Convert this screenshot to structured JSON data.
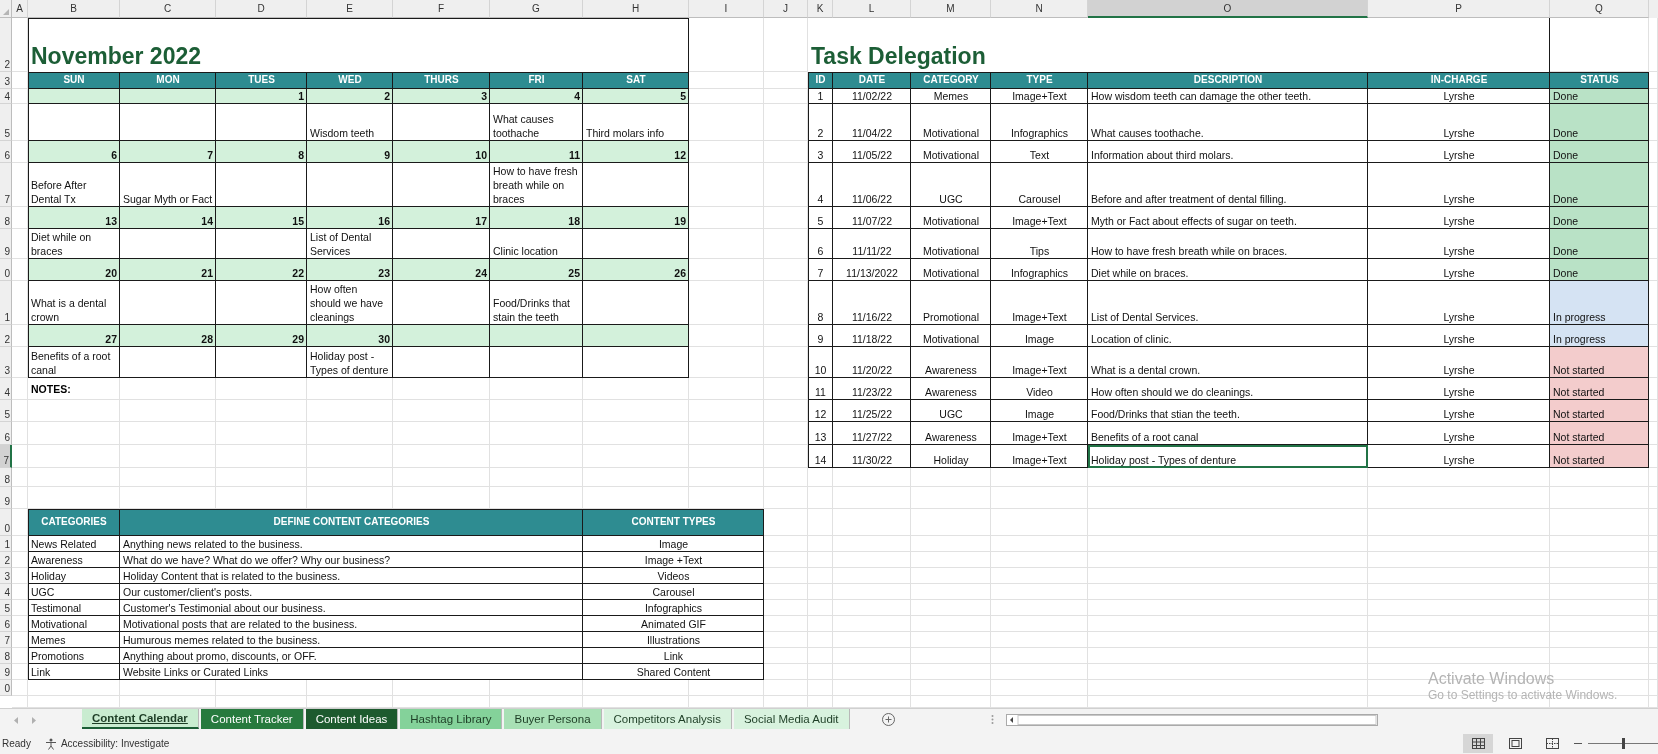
{
  "column_headers": [
    {
      "label": "A",
      "selected": false
    },
    {
      "label": "B",
      "selected": false
    },
    {
      "label": "C",
      "selected": false
    },
    {
      "label": "D",
      "selected": false
    },
    {
      "label": "E",
      "selected": false
    },
    {
      "label": "F",
      "selected": false
    },
    {
      "label": "G",
      "selected": false
    },
    {
      "label": "H",
      "selected": false
    },
    {
      "label": "I",
      "selected": false
    },
    {
      "label": "J",
      "selected": false
    },
    {
      "label": "K",
      "selected": false
    },
    {
      "label": "L",
      "selected": false
    },
    {
      "label": "M",
      "selected": false
    },
    {
      "label": "N",
      "selected": false
    },
    {
      "label": "O",
      "selected": true
    },
    {
      "label": "P",
      "selected": false
    },
    {
      "label": "Q",
      "selected": false
    }
  ],
  "row_headers": [
    {
      "label": "2",
      "selected": false
    },
    {
      "label": "3",
      "selected": false
    },
    {
      "label": "4",
      "selected": false
    },
    {
      "label": "5",
      "selected": false
    },
    {
      "label": "6",
      "selected": false
    },
    {
      "label": "7",
      "selected": false
    },
    {
      "label": "8",
      "selected": false
    },
    {
      "label": "9",
      "selected": false
    },
    {
      "label": "0",
      "selected": false
    },
    {
      "label": "1",
      "selected": false
    },
    {
      "label": "2",
      "selected": false
    },
    {
      "label": "3",
      "selected": false
    },
    {
      "label": "4",
      "selected": false
    },
    {
      "label": "5",
      "selected": false
    },
    {
      "label": "6",
      "selected": false
    },
    {
      "label": "7",
      "selected": true
    },
    {
      "label": "8",
      "selected": false
    },
    {
      "label": "9",
      "selected": false
    },
    {
      "label": "0",
      "selected": false
    },
    {
      "label": "1",
      "selected": false
    },
    {
      "label": "2",
      "selected": false
    },
    {
      "label": "3",
      "selected": false
    },
    {
      "label": "4",
      "selected": false
    },
    {
      "label": "5",
      "selected": false
    },
    {
      "label": "6",
      "selected": false
    },
    {
      "label": "7",
      "selected": false
    },
    {
      "label": "8",
      "selected": false
    },
    {
      "label": "9",
      "selected": false
    },
    {
      "label": "0",
      "selected": false
    }
  ],
  "calendar": {
    "title": "November 2022",
    "weekdays": [
      "SUN",
      "MON",
      "TUES",
      "WED",
      "THURS",
      "FRI",
      "SAT"
    ],
    "weeks": [
      {
        "days": [
          {
            "kind": "empty"
          },
          {
            "kind": "empty"
          },
          {
            "day": "1"
          },
          {
            "day": "2",
            "post": "Wisdom teeth"
          },
          {
            "day": "3"
          },
          {
            "day": "4",
            "post": "What causes toothache"
          },
          {
            "day": "5",
            "post": "Third molars info"
          }
        ]
      },
      {
        "days": [
          {
            "day": "6",
            "post": "Before After Dental Tx"
          },
          {
            "day": "7",
            "post": "Sugar Myth or Fact"
          },
          {
            "day": "8"
          },
          {
            "day": "9"
          },
          {
            "day": "10"
          },
          {
            "day": "11",
            "post": "How to have fresh breath while on braces"
          },
          {
            "day": "12"
          }
        ]
      },
      {
        "days": [
          {
            "day": "13",
            "post": "Diet while on braces"
          },
          {
            "day": "14"
          },
          {
            "day": "15"
          },
          {
            "day": "16",
            "post": "List of Dental Services"
          },
          {
            "day": "17"
          },
          {
            "day": "18",
            "post": "Clinic location"
          },
          {
            "day": "19"
          }
        ]
      },
      {
        "days": [
          {
            "day": "20",
            "post": "What is a dental crown"
          },
          {
            "day": "21"
          },
          {
            "day": "22"
          },
          {
            "day": "23",
            "post": "How often should we have cleanings"
          },
          {
            "day": "24"
          },
          {
            "day": "25",
            "post": "Food/Drinks that stain the teeth"
          },
          {
            "day": "26"
          }
        ]
      },
      {
        "days": [
          {
            "day": "27",
            "post": "Benefits of a root canal"
          },
          {
            "day": "28"
          },
          {
            "day": "29"
          },
          {
            "day": "30",
            "post": "Holiday post - Types of denture"
          },
          {
            "kind": "empty"
          },
          {
            "kind": "empty"
          },
          {
            "kind": "empty"
          }
        ]
      }
    ],
    "notes_label": "NOTES:"
  },
  "task_delegation": {
    "title": "Task Delegation",
    "columns": [
      "ID",
      "DATE",
      "CATEGORY",
      "TYPE",
      "DESCRIPTION",
      "IN-CHARGE",
      "STATUS"
    ],
    "rows": [
      {
        "id": "1",
        "date": "11/02/22",
        "category": "Memes",
        "type": "Image+Text",
        "description": "How wisdom teeth can damage the other teeth.",
        "in_charge": "Lyrshe",
        "status": "Done",
        "color": "#b9e2c6",
        "selected": false
      },
      {
        "id": "2",
        "date": "11/04/22",
        "category": "Motivational",
        "type": "Infographics",
        "description": "What causes toothache.",
        "in_charge": "Lyrshe",
        "status": "Done",
        "color": "#b9e2c6",
        "selected": false
      },
      {
        "id": "3",
        "date": "11/05/22",
        "category": "Motivational",
        "type": "Text",
        "description": "Information about third molars.",
        "in_charge": "Lyrshe",
        "status": "Done",
        "color": "#b9e2c6",
        "selected": false
      },
      {
        "id": "4",
        "date": "11/06/22",
        "category": "UGC",
        "type": "Carousel",
        "description": "Before and after treatment of dental filling.",
        "in_charge": "Lyrshe",
        "status": "Done",
        "color": "#b9e2c6",
        "selected": false
      },
      {
        "id": "5",
        "date": "11/07/22",
        "category": "Motivational",
        "type": "Image+Text",
        "description": "Myth or Fact about effects of sugar on teeth.",
        "in_charge": "Lyrshe",
        "status": "Done",
        "color": "#b9e2c6",
        "selected": false
      },
      {
        "id": "6",
        "date": "11/11/22",
        "category": "Motivational",
        "type": "Tips",
        "description": "How to have fresh breath while on braces.",
        "in_charge": "Lyrshe",
        "status": "Done",
        "color": "#b9e2c6",
        "selected": false
      },
      {
        "id": "7",
        "date": "11/13/2022",
        "category": "Motivational",
        "type": "Infographics",
        "description": "Diet while on braces.",
        "in_charge": "Lyrshe",
        "status": "Done",
        "color": "#b9e2c6",
        "selected": false
      },
      {
        "id": "8",
        "date": "11/16/22",
        "category": "Promotional",
        "type": "Image+Text",
        "description": "List of Dental Services.",
        "in_charge": "Lyrshe",
        "status": "In progress",
        "color": "#d5e3f3",
        "selected": false
      },
      {
        "id": "9",
        "date": "11/18/22",
        "category": "Motivational",
        "type": "Image",
        "description": "Location of clinic.",
        "in_charge": "Lyrshe",
        "status": "In progress",
        "color": "#d5e3f3",
        "selected": false
      },
      {
        "id": "10",
        "date": "11/20/22",
        "category": "Awareness",
        "type": "Image+Text",
        "description": "What is a dental crown.",
        "in_charge": "Lyrshe",
        "status": "Not started",
        "color": "#f3cccc",
        "selected": false
      },
      {
        "id": "11",
        "date": "11/23/22",
        "category": "Awareness",
        "type": "Video",
        "description": "How often should we do cleanings.",
        "in_charge": "Lyrshe",
        "status": "Not started",
        "color": "#f3cccc",
        "selected": false
      },
      {
        "id": "12",
        "date": "11/25/22",
        "category": "UGC",
        "type": "Image",
        "description": "Food/Drinks that stian the teeth.",
        "in_charge": "Lyrshe",
        "status": "Not started",
        "color": "#f3cccc",
        "selected": false
      },
      {
        "id": "13",
        "date": "11/27/22",
        "category": "Awareness",
        "type": "Image+Text",
        "description": "Benefits of a root canal",
        "in_charge": "Lyrshe",
        "status": "Not started",
        "color": "#f3cccc",
        "selected": false
      },
      {
        "id": "14",
        "date": "11/30/22",
        "category": "Holiday",
        "type": "Image+Text",
        "description": "Holiday post - Types of denture",
        "in_charge": "Lyrshe",
        "status": "Not started",
        "color": "#f3cccc",
        "selected": true
      }
    ]
  },
  "categories_table": {
    "columns": [
      "CATEGORIES",
      "DEFINE CONTENT CATEGORIES",
      "CONTENT TYPES"
    ],
    "rows": [
      {
        "category": "News Related",
        "definition": "Anything news related to the business.",
        "content_type": "Image"
      },
      {
        "category": "Awareness",
        "definition": "What do we have? What do we offer? Why our business?",
        "content_type": "Image +Text"
      },
      {
        "category": "Holiday",
        "definition": "Holiday Content that is related to the business.",
        "content_type": "Videos"
      },
      {
        "category": "UGC",
        "definition": "Our customer/client's posts.",
        "content_type": "Carousel"
      },
      {
        "category": "Testimonal",
        "definition": "Customer's Testimonial about our business.",
        "content_type": "Infographics"
      },
      {
        "category": "Motivational",
        "definition": "Motivational posts that are related to the business.",
        "content_type": "Animated GIF"
      },
      {
        "category": "Memes",
        "definition": "Humurous memes related to the business.",
        "content_type": "Illustrations"
      },
      {
        "category": "Promotions",
        "definition": "Anything about promo, discounts, or OFF.",
        "content_type": "Link"
      },
      {
        "category": "Link",
        "definition": "Website Links or Curated Links",
        "content_type": "Shared Content"
      }
    ]
  },
  "os_notice": {
    "title": "Activate Windows",
    "subtitle": "Go to Settings to activate Windows."
  },
  "sheet_tabs": [
    {
      "label": "Content Calendar",
      "color": "#c9ecd0",
      "selected": true
    },
    {
      "label": "Content Tracker",
      "color": "#277a3e",
      "selected": false
    },
    {
      "label": "Content Ideas",
      "color": "#1d5a2e",
      "selected": false
    },
    {
      "label": "Hashtag Library",
      "color": "#84d29a",
      "selected": false
    },
    {
      "label": "Buyer Persona",
      "color": "#a8e0b5",
      "selected": false
    },
    {
      "label": "Competitors Analysis",
      "color": "#d8f2de",
      "selected": false
    },
    {
      "label": "Social Media Audit",
      "color": "#d8f2de",
      "selected": false
    }
  ],
  "status_bar": {
    "state": "Ready",
    "accessibility": "Accessibility: Investigate",
    "view_buttons": [
      {
        "kind": "normal",
        "selected": true
      },
      {
        "kind": "page_layout",
        "selected": false
      },
      {
        "kind": "page_break",
        "selected": false
      }
    ],
    "zoom_slider": {
      "level": 0.5
    }
  }
}
